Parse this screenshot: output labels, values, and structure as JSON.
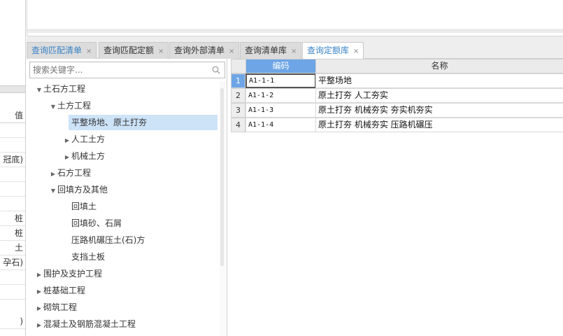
{
  "left_strip": {
    "header": "值",
    "cells": [
      "",
      "",
      "冠底)",
      "",
      "",
      "",
      "桩",
      "桩",
      "土",
      "孕石)",
      "",
      "",
      ")"
    ]
  },
  "tabs": [
    {
      "label": "查询匹配清单",
      "close": "×"
    },
    {
      "label": "查询匹配定额",
      "close": "×"
    },
    {
      "label": "查询外部清单",
      "close": "×"
    },
    {
      "label": "查询清单库",
      "close": "×"
    },
    {
      "label": "查询定额库",
      "close": "×"
    }
  ],
  "search": {
    "placeholder": "搜索关键字..."
  },
  "tree": [
    {
      "label": "土石方工程",
      "toggle": "▼"
    },
    {
      "label": "土方工程",
      "toggle": "▼"
    },
    {
      "label": "平整场地、原土打夯",
      "toggle": ""
    },
    {
      "label": "人工土方",
      "toggle": "▶"
    },
    {
      "label": "机械土方",
      "toggle": "▶"
    },
    {
      "label": "石方工程",
      "toggle": "▶"
    },
    {
      "label": "回填方及其他",
      "toggle": "▼"
    },
    {
      "label": "回填土",
      "toggle": ""
    },
    {
      "label": "回填砂、石屑",
      "toggle": ""
    },
    {
      "label": "压路机碾压土(石)方",
      "toggle": ""
    },
    {
      "label": "支挡土板",
      "toggle": ""
    },
    {
      "label": "围护及支护工程",
      "toggle": "▶"
    },
    {
      "label": "桩基础工程",
      "toggle": "▶"
    },
    {
      "label": "砌筑工程",
      "toggle": "▶"
    },
    {
      "label": "混凝土及钢筋混凝土工程",
      "toggle": "▶"
    }
  ],
  "grid": {
    "columns": [
      "编码",
      "名称"
    ],
    "rows": [
      {
        "num": "1",
        "code": "A1-1-1",
        "name": "平整场地"
      },
      {
        "num": "2",
        "code": "A1-1-2",
        "name": "原土打夯 人工夯实"
      },
      {
        "num": "3",
        "code": "A1-1-3",
        "name": "原土打夯 机械夯实 夯实机夯实"
      },
      {
        "num": "4",
        "code": "A1-1-4",
        "name": "原土打夯 机械夯实 压路机碾压"
      }
    ]
  }
}
